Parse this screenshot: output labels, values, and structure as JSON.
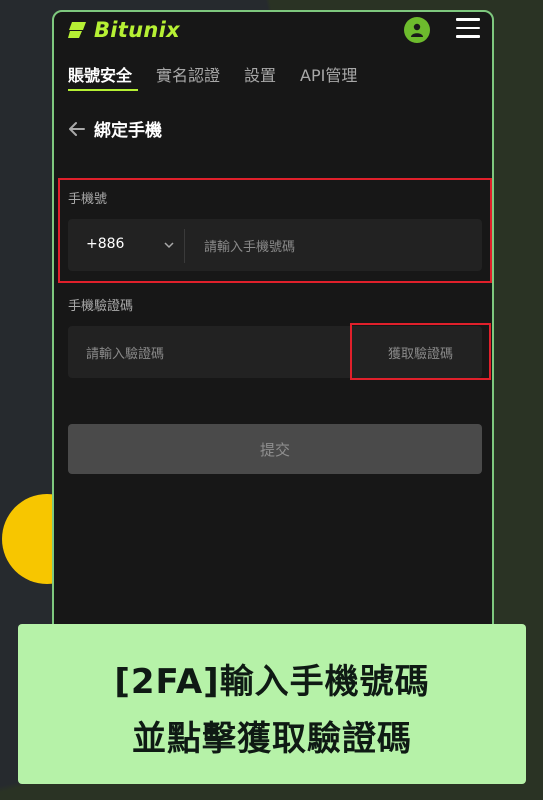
{
  "header": {
    "brand": "Bitunix",
    "logo_icon": "bitunix-logo-icon",
    "avatar_icon": "user-avatar-icon",
    "menu_icon": "hamburger-menu-icon"
  },
  "tabs": [
    {
      "label": "賬號安全",
      "active": true
    },
    {
      "label": "實名認證",
      "active": false
    },
    {
      "label": "設置",
      "active": false
    },
    {
      "label": "API管理",
      "active": false
    }
  ],
  "page": {
    "back_icon": "back-arrow-icon",
    "title": "綁定手機"
  },
  "form": {
    "phone_label": "手機號",
    "country_code": "+886",
    "phone_placeholder": "請輸入手機號碼",
    "code_label": "手機驗證碼",
    "code_placeholder": "請輸入驗證碼",
    "get_code_label": "獲取驗證碼",
    "submit_label": "提交"
  },
  "caption": {
    "line1": "[2FA]輸入手機號碼",
    "line2": "並點擊獲取驗證碼"
  },
  "colors": {
    "accent": "#b6f034",
    "highlight": "#e0202b",
    "caption_bg": "#b6f2a8"
  }
}
